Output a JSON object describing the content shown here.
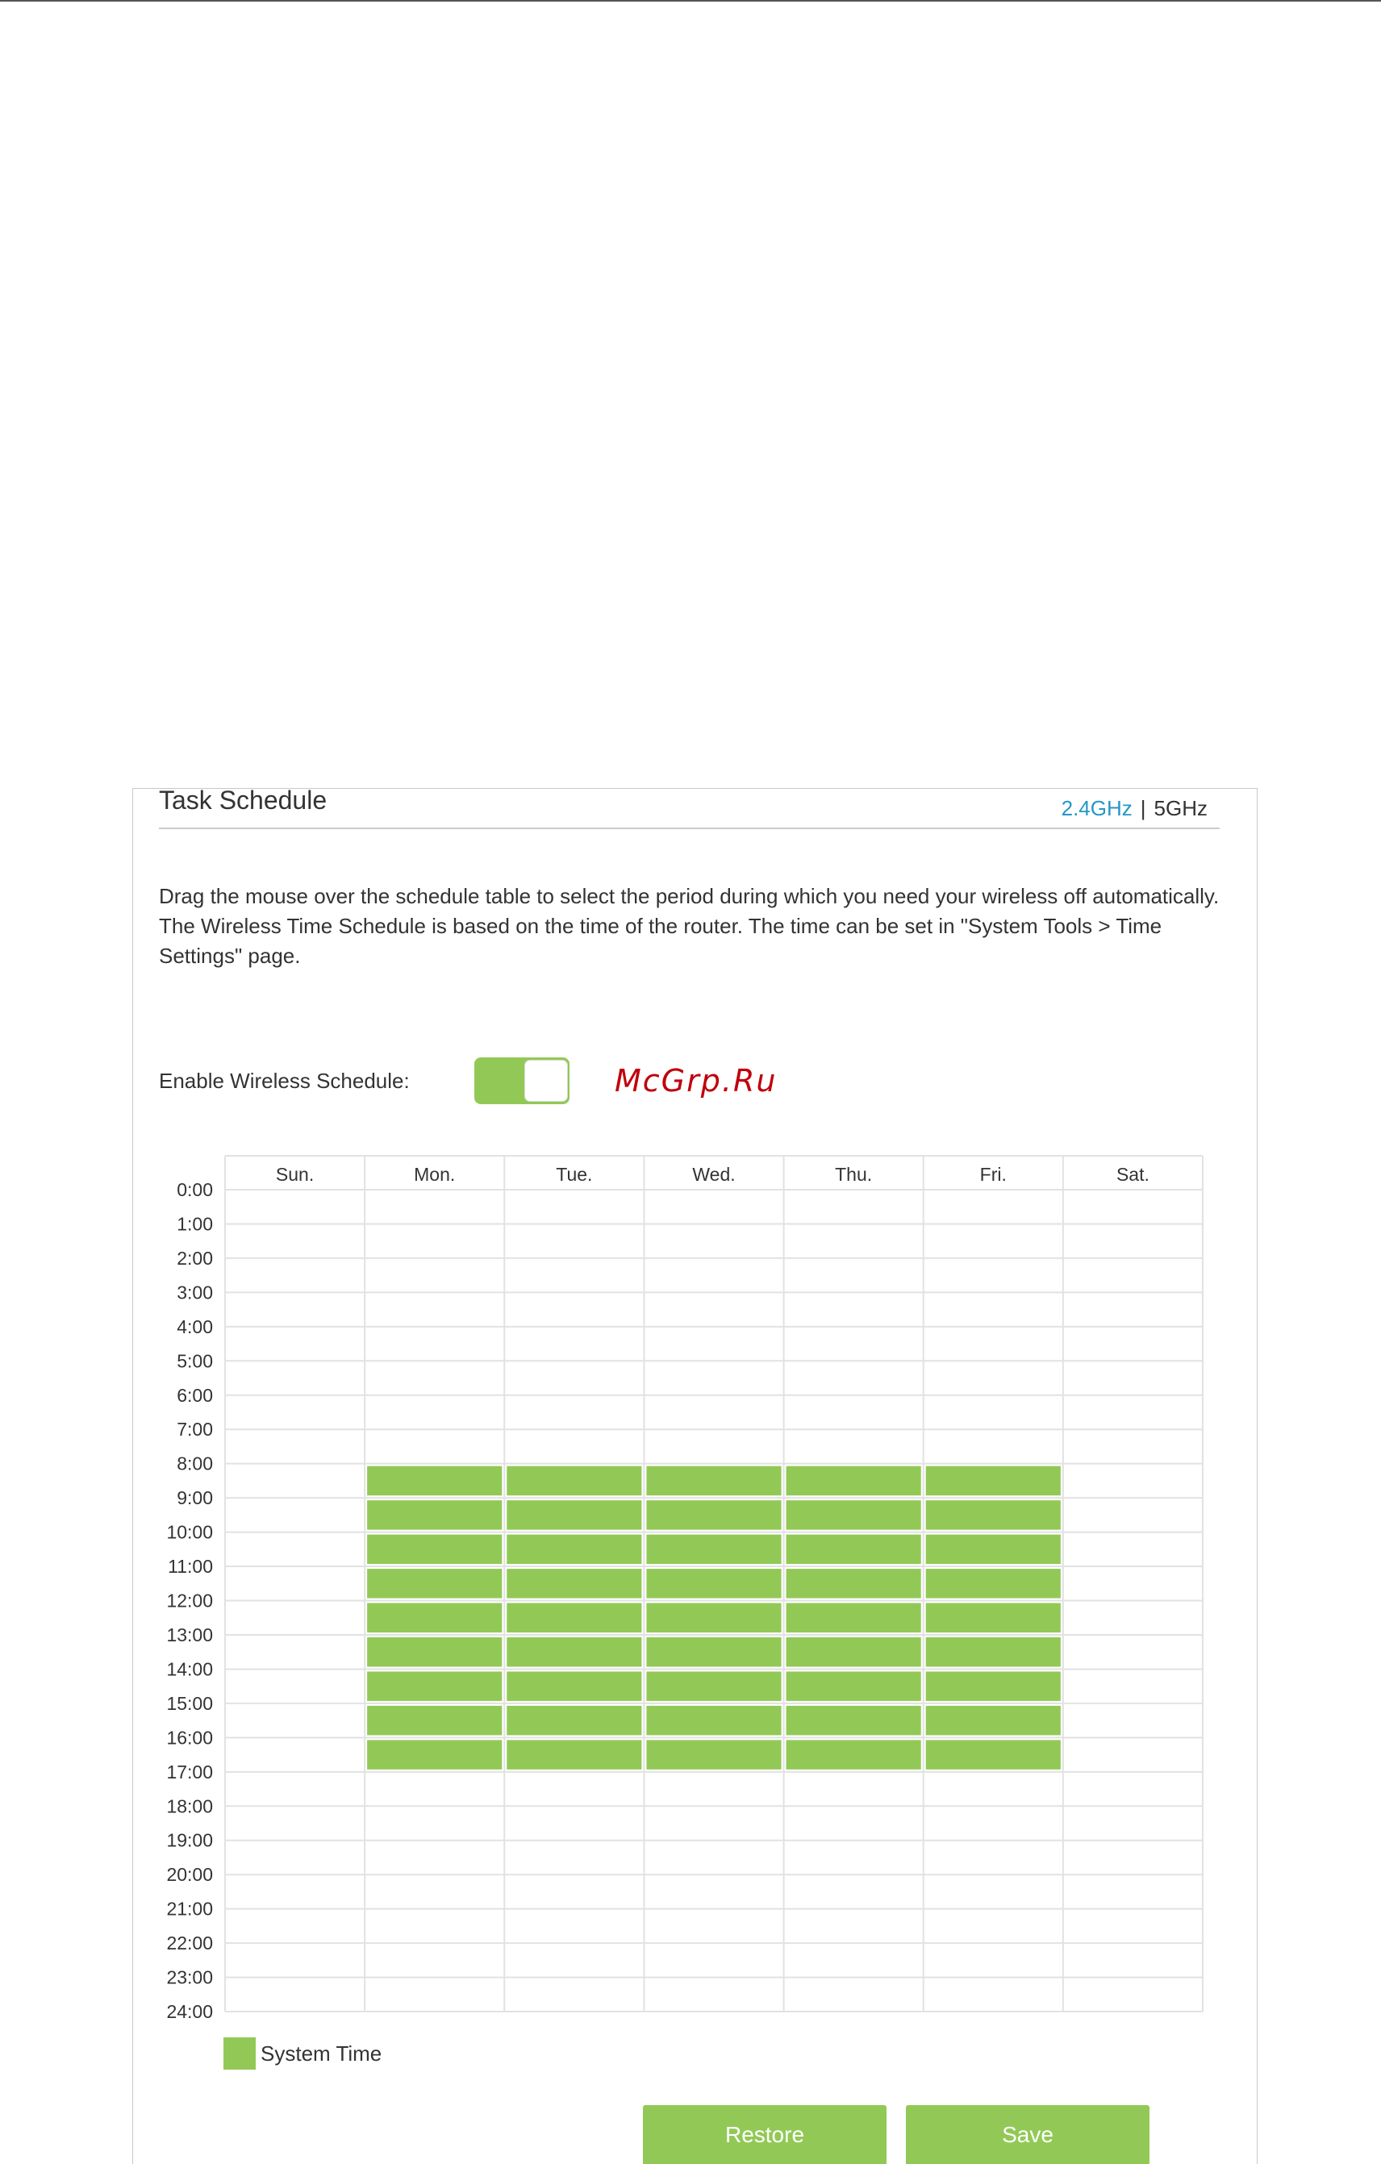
{
  "header": {
    "title": "Task Schedule",
    "band_24": "2.4GHz",
    "band_separator": "|",
    "band_5": "5GHz",
    "active_band_color": "#2596c9"
  },
  "description": {
    "line1": "Drag the mouse over the schedule table to select the period during which you need your wireless off automatically.",
    "line2": "The Wireless Time Schedule is based on the time of the router. The time can be set in \"System Tools > Time Settings\" page."
  },
  "enable": {
    "label": "Enable Wireless Schedule:",
    "toggle_on": true
  },
  "watermark": "McGrp.Ru",
  "schedule": {
    "days": [
      "Sun.",
      "Mon.",
      "Tue.",
      "Wed.",
      "Thu.",
      "Fri.",
      "Sat."
    ],
    "hours": [
      "0:00",
      "1:00",
      "2:00",
      "3:00",
      "4:00",
      "5:00",
      "6:00",
      "7:00",
      "8:00",
      "9:00",
      "10:00",
      "11:00",
      "12:00",
      "13:00",
      "14:00",
      "15:00",
      "16:00",
      "17:00",
      "18:00",
      "19:00",
      "20:00",
      "21:00",
      "22:00",
      "23:00",
      "24:00"
    ],
    "selected_days": [
      1,
      2,
      3,
      4,
      5
    ],
    "selected_start_hour": 8,
    "selected_end_hour": 17,
    "selected_color": "#92c956"
  },
  "legend": {
    "label": "System Time",
    "color": "#92c956"
  },
  "buttons": {
    "restore": "Restore",
    "save": "Save"
  }
}
